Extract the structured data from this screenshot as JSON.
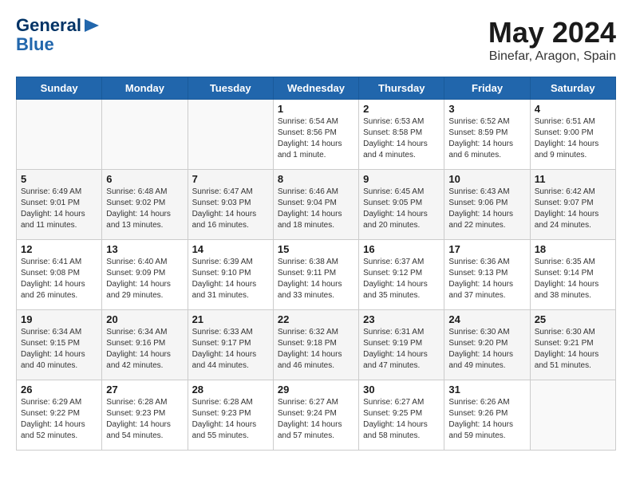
{
  "header": {
    "logo_line1": "General",
    "logo_line2": "Blue",
    "month": "May 2024",
    "location": "Binefar, Aragon, Spain"
  },
  "weekdays": [
    "Sunday",
    "Monday",
    "Tuesday",
    "Wednesday",
    "Thursday",
    "Friday",
    "Saturday"
  ],
  "weeks": [
    [
      {
        "day": "",
        "sunrise": "",
        "sunset": "",
        "daylight": ""
      },
      {
        "day": "",
        "sunrise": "",
        "sunset": "",
        "daylight": ""
      },
      {
        "day": "",
        "sunrise": "",
        "sunset": "",
        "daylight": ""
      },
      {
        "day": "1",
        "sunrise": "Sunrise: 6:54 AM",
        "sunset": "Sunset: 8:56 PM",
        "daylight": "Daylight: 14 hours and 1 minute."
      },
      {
        "day": "2",
        "sunrise": "Sunrise: 6:53 AM",
        "sunset": "Sunset: 8:58 PM",
        "daylight": "Daylight: 14 hours and 4 minutes."
      },
      {
        "day": "3",
        "sunrise": "Sunrise: 6:52 AM",
        "sunset": "Sunset: 8:59 PM",
        "daylight": "Daylight: 14 hours and 6 minutes."
      },
      {
        "day": "4",
        "sunrise": "Sunrise: 6:51 AM",
        "sunset": "Sunset: 9:00 PM",
        "daylight": "Daylight: 14 hours and 9 minutes."
      }
    ],
    [
      {
        "day": "5",
        "sunrise": "Sunrise: 6:49 AM",
        "sunset": "Sunset: 9:01 PM",
        "daylight": "Daylight: 14 hours and 11 minutes."
      },
      {
        "day": "6",
        "sunrise": "Sunrise: 6:48 AM",
        "sunset": "Sunset: 9:02 PM",
        "daylight": "Daylight: 14 hours and 13 minutes."
      },
      {
        "day": "7",
        "sunrise": "Sunrise: 6:47 AM",
        "sunset": "Sunset: 9:03 PM",
        "daylight": "Daylight: 14 hours and 16 minutes."
      },
      {
        "day": "8",
        "sunrise": "Sunrise: 6:46 AM",
        "sunset": "Sunset: 9:04 PM",
        "daylight": "Daylight: 14 hours and 18 minutes."
      },
      {
        "day": "9",
        "sunrise": "Sunrise: 6:45 AM",
        "sunset": "Sunset: 9:05 PM",
        "daylight": "Daylight: 14 hours and 20 minutes."
      },
      {
        "day": "10",
        "sunrise": "Sunrise: 6:43 AM",
        "sunset": "Sunset: 9:06 PM",
        "daylight": "Daylight: 14 hours and 22 minutes."
      },
      {
        "day": "11",
        "sunrise": "Sunrise: 6:42 AM",
        "sunset": "Sunset: 9:07 PM",
        "daylight": "Daylight: 14 hours and 24 minutes."
      }
    ],
    [
      {
        "day": "12",
        "sunrise": "Sunrise: 6:41 AM",
        "sunset": "Sunset: 9:08 PM",
        "daylight": "Daylight: 14 hours and 26 minutes."
      },
      {
        "day": "13",
        "sunrise": "Sunrise: 6:40 AM",
        "sunset": "Sunset: 9:09 PM",
        "daylight": "Daylight: 14 hours and 29 minutes."
      },
      {
        "day": "14",
        "sunrise": "Sunrise: 6:39 AM",
        "sunset": "Sunset: 9:10 PM",
        "daylight": "Daylight: 14 hours and 31 minutes."
      },
      {
        "day": "15",
        "sunrise": "Sunrise: 6:38 AM",
        "sunset": "Sunset: 9:11 PM",
        "daylight": "Daylight: 14 hours and 33 minutes."
      },
      {
        "day": "16",
        "sunrise": "Sunrise: 6:37 AM",
        "sunset": "Sunset: 9:12 PM",
        "daylight": "Daylight: 14 hours and 35 minutes."
      },
      {
        "day": "17",
        "sunrise": "Sunrise: 6:36 AM",
        "sunset": "Sunset: 9:13 PM",
        "daylight": "Daylight: 14 hours and 37 minutes."
      },
      {
        "day": "18",
        "sunrise": "Sunrise: 6:35 AM",
        "sunset": "Sunset: 9:14 PM",
        "daylight": "Daylight: 14 hours and 38 minutes."
      }
    ],
    [
      {
        "day": "19",
        "sunrise": "Sunrise: 6:34 AM",
        "sunset": "Sunset: 9:15 PM",
        "daylight": "Daylight: 14 hours and 40 minutes."
      },
      {
        "day": "20",
        "sunrise": "Sunrise: 6:34 AM",
        "sunset": "Sunset: 9:16 PM",
        "daylight": "Daylight: 14 hours and 42 minutes."
      },
      {
        "day": "21",
        "sunrise": "Sunrise: 6:33 AM",
        "sunset": "Sunset: 9:17 PM",
        "daylight": "Daylight: 14 hours and 44 minutes."
      },
      {
        "day": "22",
        "sunrise": "Sunrise: 6:32 AM",
        "sunset": "Sunset: 9:18 PM",
        "daylight": "Daylight: 14 hours and 46 minutes."
      },
      {
        "day": "23",
        "sunrise": "Sunrise: 6:31 AM",
        "sunset": "Sunset: 9:19 PM",
        "daylight": "Daylight: 14 hours and 47 minutes."
      },
      {
        "day": "24",
        "sunrise": "Sunrise: 6:30 AM",
        "sunset": "Sunset: 9:20 PM",
        "daylight": "Daylight: 14 hours and 49 minutes."
      },
      {
        "day": "25",
        "sunrise": "Sunrise: 6:30 AM",
        "sunset": "Sunset: 9:21 PM",
        "daylight": "Daylight: 14 hours and 51 minutes."
      }
    ],
    [
      {
        "day": "26",
        "sunrise": "Sunrise: 6:29 AM",
        "sunset": "Sunset: 9:22 PM",
        "daylight": "Daylight: 14 hours and 52 minutes."
      },
      {
        "day": "27",
        "sunrise": "Sunrise: 6:28 AM",
        "sunset": "Sunset: 9:23 PM",
        "daylight": "Daylight: 14 hours and 54 minutes."
      },
      {
        "day": "28",
        "sunrise": "Sunrise: 6:28 AM",
        "sunset": "Sunset: 9:23 PM",
        "daylight": "Daylight: 14 hours and 55 minutes."
      },
      {
        "day": "29",
        "sunrise": "Sunrise: 6:27 AM",
        "sunset": "Sunset: 9:24 PM",
        "daylight": "Daylight: 14 hours and 57 minutes."
      },
      {
        "day": "30",
        "sunrise": "Sunrise: 6:27 AM",
        "sunset": "Sunset: 9:25 PM",
        "daylight": "Daylight: 14 hours and 58 minutes."
      },
      {
        "day": "31",
        "sunrise": "Sunrise: 6:26 AM",
        "sunset": "Sunset: 9:26 PM",
        "daylight": "Daylight: 14 hours and 59 minutes."
      },
      {
        "day": "",
        "sunrise": "",
        "sunset": "",
        "daylight": ""
      }
    ]
  ]
}
